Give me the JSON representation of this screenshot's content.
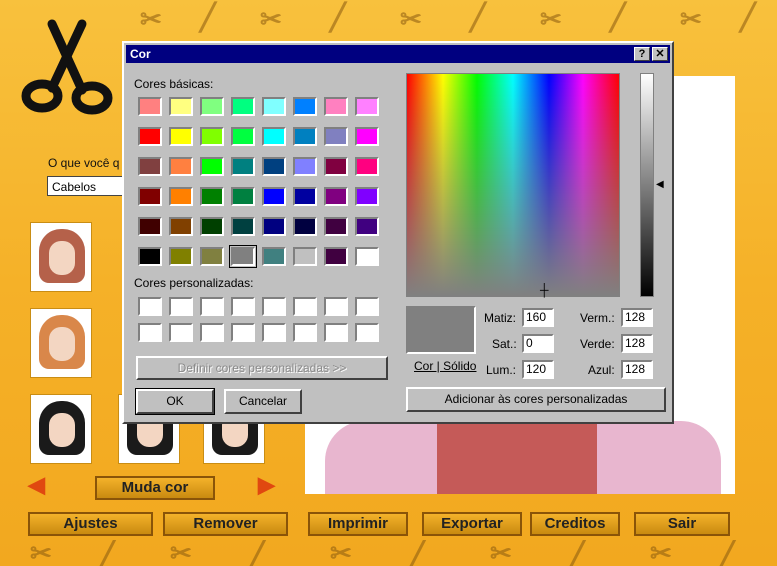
{
  "app": {
    "prompt_label": "O que você q",
    "category_value": "Cabelos",
    "change_color_button": "Muda cor",
    "bottom_buttons": [
      "Ajustes",
      "Remover",
      "Imprimir",
      "Exportar",
      "Creditos",
      "Sair"
    ],
    "arrow_left": "◀",
    "arrow_right": "▶"
  },
  "dialog": {
    "title": "Cor",
    "help_button": "?",
    "close_button": "✕",
    "basic_colors_label": "Cores básicas:",
    "custom_colors_label": "Cores personalizadas:",
    "define_custom_button": "Definir cores personalizadas >>",
    "ok_button": "OK",
    "cancel_button": "Cancelar",
    "solid_color_label": "Cor | Sólido",
    "add_custom_button": "Adicionar às cores personalizadas",
    "fields": {
      "hue_label": "Matiz:",
      "hue_value": "160",
      "sat_label": "Sat.:",
      "sat_value": "0",
      "lum_label": "Lum.:",
      "lum_value": "120",
      "red_label": "Verm.:",
      "red_value": "128",
      "green_label": "Verde:",
      "green_value": "128",
      "blue_label": "Azul:",
      "blue_value": "128"
    },
    "basic_colors": [
      [
        "#ff8080",
        "#ffff80",
        "#80ff80",
        "#00ff80",
        "#80ffff",
        "#0080ff",
        "#ff80c0",
        "#ff80ff"
      ],
      [
        "#ff0000",
        "#ffff00",
        "#80ff00",
        "#00ff40",
        "#00ffff",
        "#0080c0",
        "#8080c0",
        "#ff00ff"
      ],
      [
        "#804040",
        "#ff8040",
        "#00ff00",
        "#008080",
        "#004080",
        "#8080ff",
        "#800040",
        "#ff0080"
      ],
      [
        "#800000",
        "#ff8000",
        "#008000",
        "#008040",
        "#0000ff",
        "#0000a0",
        "#800080",
        "#8000ff"
      ],
      [
        "#400000",
        "#804000",
        "#004000",
        "#004040",
        "#000080",
        "#000040",
        "#400040",
        "#400080"
      ],
      [
        "#000000",
        "#808000",
        "#808040",
        "#808080",
        "#408080",
        "#c0c0c0",
        "#400040",
        "#ffffff"
      ]
    ],
    "selected_color": "#808080",
    "custom_color_fill": "#ffffff"
  }
}
